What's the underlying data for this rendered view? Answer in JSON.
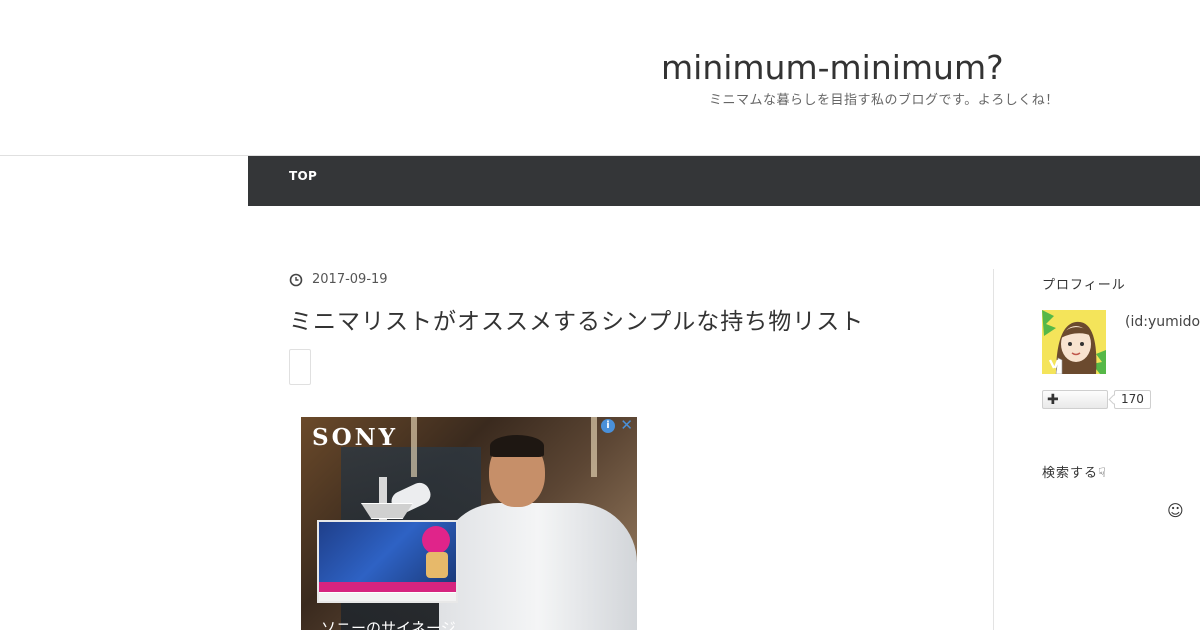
{
  "header": {
    "title": "minimum-minimum?",
    "description": "ミニマムな暮らしを目指す私のブログです。よろしくね！"
  },
  "nav": {
    "items": [
      {
        "label": "TOP"
      }
    ]
  },
  "entry": {
    "date": "2017-09-19",
    "title": "ミニマリストがオススメするシンプルな持ち物リスト"
  },
  "ad": {
    "brand": "SONY",
    "caption": "ソニーのサイネージ",
    "choices_icon": "i",
    "close_icon": "✕"
  },
  "sidebar": {
    "profile_heading": "プロフィール",
    "user_id": "(id:yumido",
    "follow_icon": "✚",
    "follower_count": "170",
    "search_heading": "検索する☟",
    "smile_icon": "☺"
  },
  "colors": {
    "nav_bg": "#343638",
    "ad_choices_blue": "#4a90d9"
  }
}
